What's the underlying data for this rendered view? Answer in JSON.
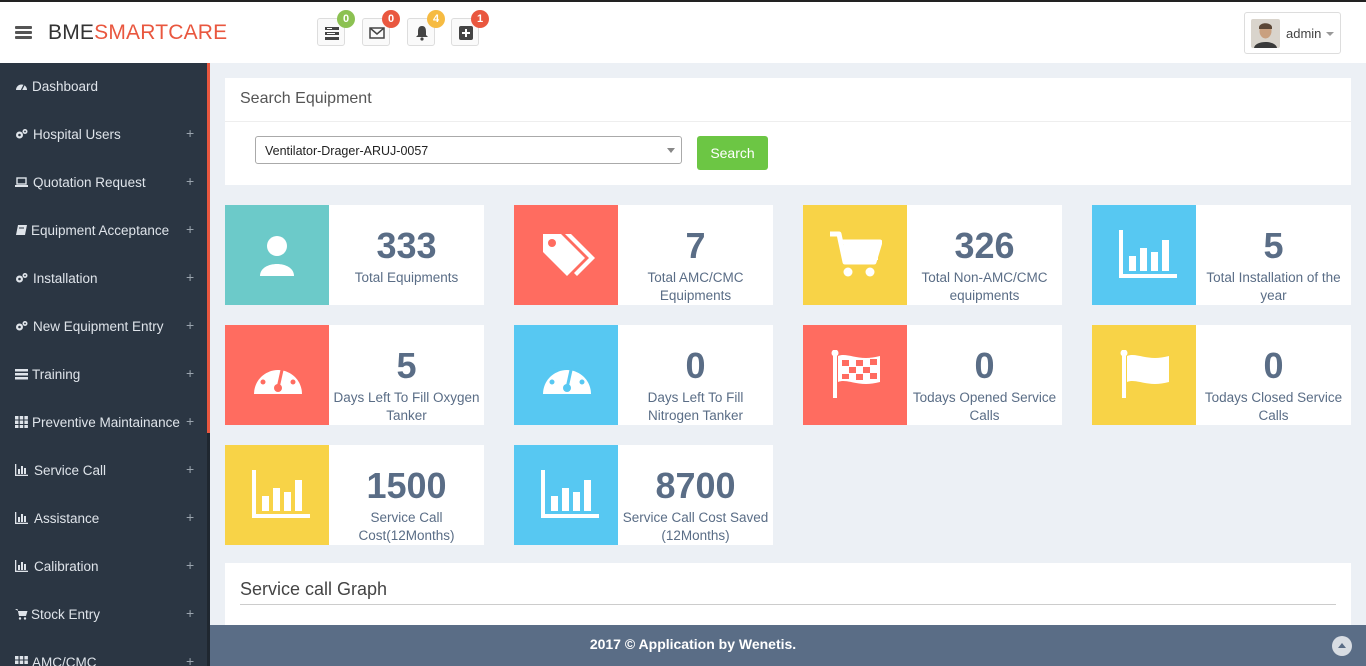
{
  "brand": {
    "part1": "BME",
    "part2": "SMARTCARE"
  },
  "header": {
    "icons": [
      {
        "name": "tasks-icon",
        "badge": "0",
        "badge_color": "#8cc152"
      },
      {
        "name": "envelope-icon",
        "badge": "0",
        "badge_color": "#e9573f"
      },
      {
        "name": "bell-icon",
        "badge": "4",
        "badge_color": "#f6bb42"
      },
      {
        "name": "plus-square-icon",
        "badge": "1",
        "badge_color": "#e9573f"
      }
    ],
    "user": "admin"
  },
  "sidebar": {
    "items": [
      {
        "label": "Dashboard",
        "icon": "dashboard-icon",
        "plus": ""
      },
      {
        "label": "Hospital Users",
        "icon": "gears-icon",
        "plus": "+"
      },
      {
        "label": "Quotation Request",
        "icon": "laptop-icon",
        "plus": "+"
      },
      {
        "label": "Equipment Acceptance",
        "icon": "book-icon",
        "plus": "+"
      },
      {
        "label": "Installation",
        "icon": "gears-icon",
        "plus": "+"
      },
      {
        "label": "New Equipment Entry",
        "icon": "gears-icon",
        "plus": "+"
      },
      {
        "label": "Training",
        "icon": "list-icon",
        "plus": "+"
      },
      {
        "label": "Preventive Maintainance",
        "icon": "grid-icon",
        "plus": "+"
      },
      {
        "label": "Service Call",
        "icon": "bar-chart-icon",
        "plus": "+"
      },
      {
        "label": "Assistance",
        "icon": "bar-chart-icon",
        "plus": "+"
      },
      {
        "label": "Calibration",
        "icon": "bar-chart-icon",
        "plus": "+"
      },
      {
        "label": "Stock Entry",
        "icon": "cart-icon",
        "plus": "+"
      },
      {
        "label": "AMC/CMC",
        "icon": "grid-icon",
        "plus": "+"
      }
    ]
  },
  "search": {
    "title": "Search Equipment",
    "selected": "Ventilator-Drager-ARUJ-0057",
    "button": "Search"
  },
  "cards": [
    {
      "value": "333",
      "label": "Total Equipments",
      "color": "#6ccac9",
      "icon": "user-icon"
    },
    {
      "value": "7",
      "label": "Total AMC/CMC Equipments",
      "color": "#ff6c60",
      "icon": "tags-icon"
    },
    {
      "value": "326",
      "label": "Total Non-AMC/CMC equipments",
      "color": "#f8d347",
      "icon": "cart-icon"
    },
    {
      "value": "5",
      "label": "Total Installation of the year",
      "color": "#57c8f2",
      "icon": "bar-chart-icon"
    },
    {
      "value": "5",
      "label": "Days Left To Fill Oxygen Tanker",
      "color": "#ff6c60",
      "icon": "gauge-icon"
    },
    {
      "value": "0",
      "label": "Days Left To Fill Nitrogen Tanker",
      "color": "#57c8f2",
      "icon": "gauge-icon"
    },
    {
      "value": "0",
      "label": "Todays Opened Service Calls",
      "color": "#ff6c60",
      "icon": "checkered-flag-icon"
    },
    {
      "value": "0",
      "label": "Todays Closed Service Calls",
      "color": "#f8d347",
      "icon": "flag-icon"
    },
    {
      "value": "1500",
      "label": "Service Call Cost(12Months)",
      "color": "#f8d347",
      "icon": "bar-chart-icon"
    },
    {
      "value": "8700",
      "label": "Service Call Cost Saved (12Months)",
      "color": "#57c8f2",
      "icon": "bar-chart-icon"
    }
  ],
  "graph": {
    "title": "Service call Graph"
  },
  "footer": {
    "text": "2017 © Application by Wenetis."
  }
}
